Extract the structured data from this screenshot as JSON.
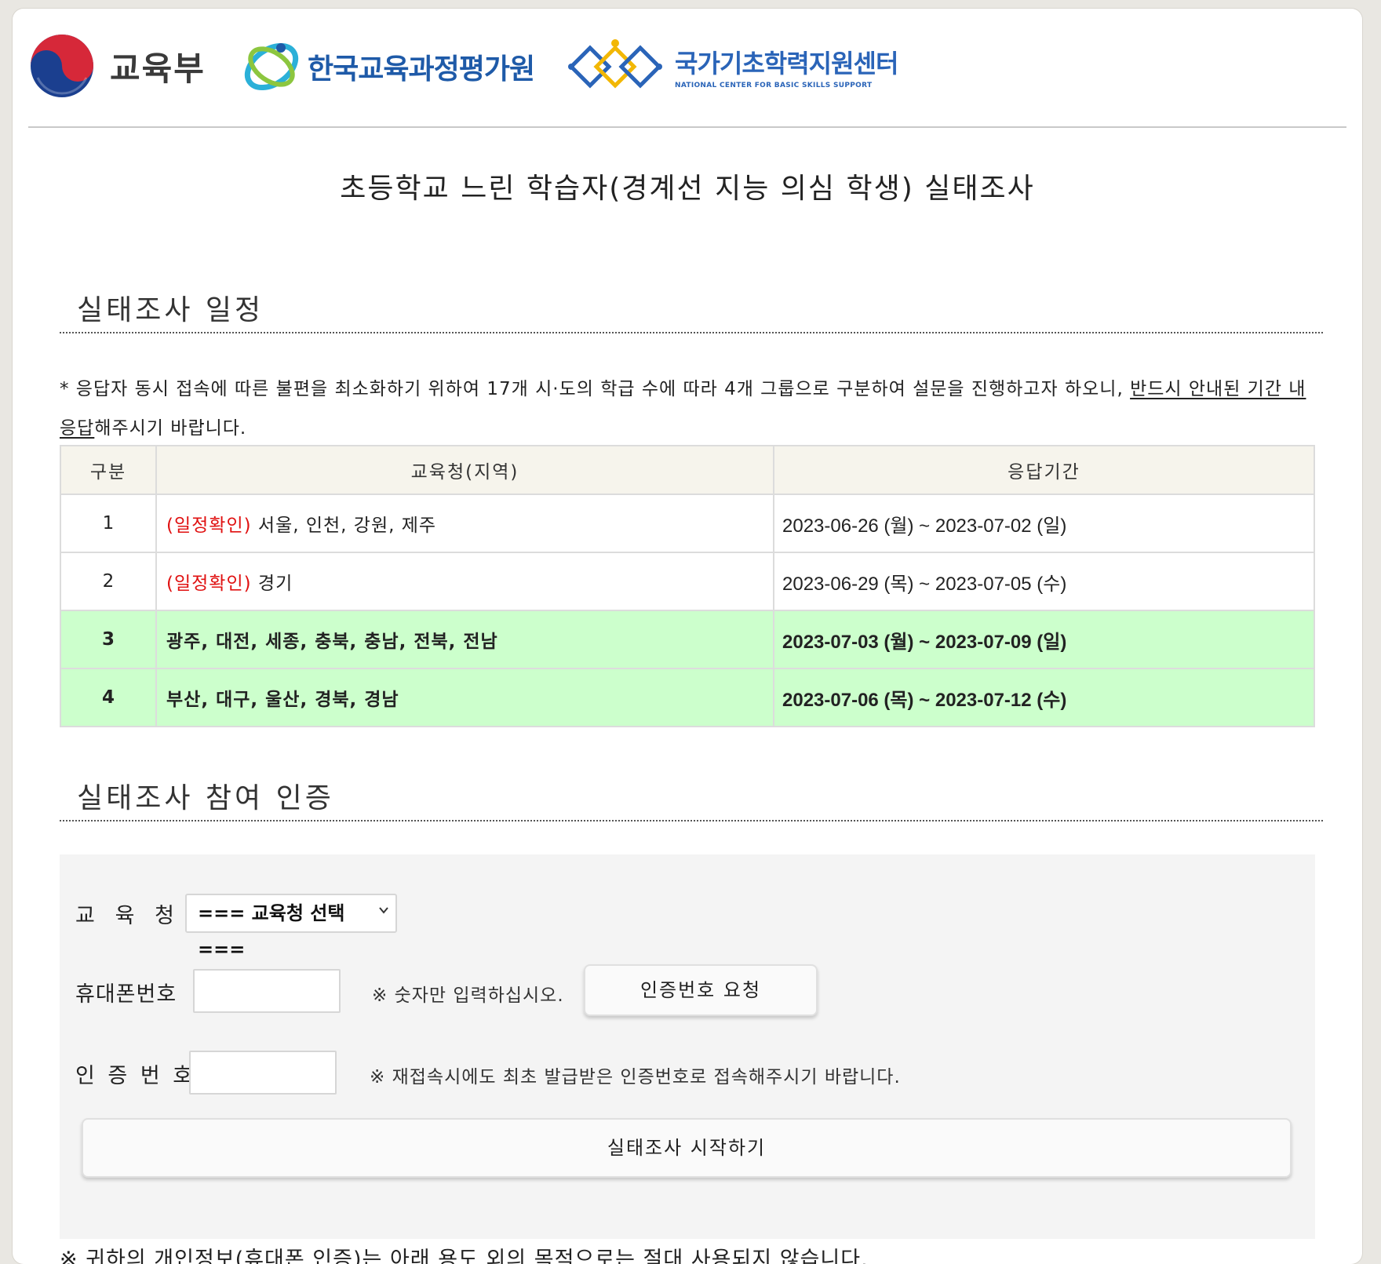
{
  "logos": {
    "moe": "교육부",
    "kice": "한국교육과정평가원",
    "basic_center": "국가기초학력지원센터",
    "basic_center_en": "NATIONAL CENTER FOR BASIC SKILLS SUPPORT"
  },
  "page_title": "초등학교 느린 학습자(경계선 지능 의심 학생) 실태조사",
  "schedule": {
    "section_title": "실태조사 일정",
    "notice_main": "* 응답자 동시 접속에 따른 불편을 최소화하기 위하여 17개 시·도의 학급 수에 따라 4개 그룹으로 구분하여 설문을 진행하고자 하오니, ",
    "notice_underlined": "반드시 안내된 기간 내 응답",
    "notice_end": "해주시기 바랍니다.",
    "columns": [
      "구분",
      "교육청(지역)",
      "응답기간"
    ],
    "rows": [
      {
        "num": "1",
        "tag": "(일정확인)",
        "region": "서울, 인천, 강원, 제주",
        "period": "2023-06-26 (월) ~ 2023-07-02 (일)"
      },
      {
        "num": "2",
        "tag": "(일정확인)",
        "region": "경기",
        "period": "2023-06-29 (목) ~ 2023-07-05 (수)"
      },
      {
        "num": "3",
        "tag": "",
        "region": "광주, 대전, 세종, 충북, 충남, 전북, 전남",
        "period": "2023-07-03 (월) ~ 2023-07-09 (일)"
      },
      {
        "num": "4",
        "tag": "",
        "region": "부산, 대구, 울산, 경북, 경남",
        "period": "2023-07-06 (목) ~ 2023-07-12 (수)"
      }
    ],
    "highlight_color": "#ccffcc",
    "tag_color": "#e01010"
  },
  "auth": {
    "section_title": "실태조사 참여 인증",
    "office_label": "교   육   청",
    "office_select_value": "=== 교육청 선택 ===",
    "phone_label": "휴대폰번호",
    "phone_value": "",
    "phone_hint": "※ 숫자만 입력하십시오.",
    "request_button": "인증번호 요청",
    "code_label": "인 증 번 호",
    "code_value": "",
    "code_hint": "※ 재접속시에도 최초 발급받은 인증번호로 접속해주시기 바랍니다.",
    "start_button": "실태조사 시작하기"
  },
  "footnote": "※ 귀하의 개인정보(휴대폰 인증)는 아래 용도 외의 목적으로는 절대 사용되지 않습니다."
}
